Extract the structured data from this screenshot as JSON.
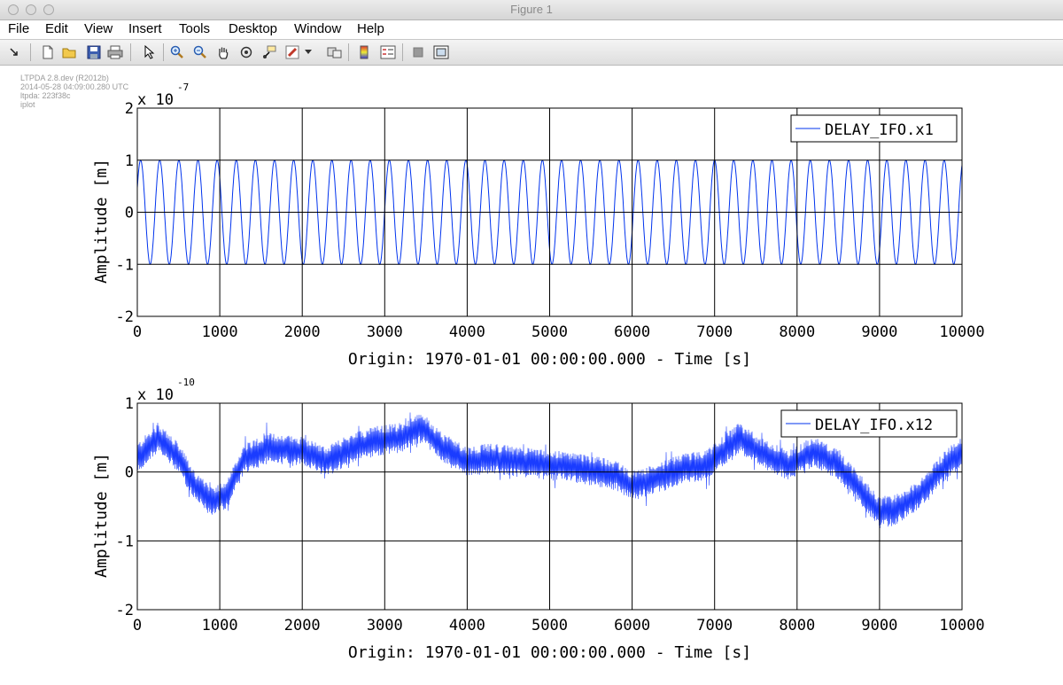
{
  "window": {
    "title": "Figure 1"
  },
  "menu": [
    "File",
    "Edit",
    "View",
    "Insert",
    "Tools",
    "Desktop",
    "Window",
    "Help"
  ],
  "toolbar": {
    "buttons": [
      "dock-arrow-icon",
      "new-figure-icon",
      "open-file-icon",
      "save-icon",
      "print-icon",
      "edit-plot-arrow-icon",
      "zoom-in-icon",
      "zoom-out-icon",
      "pan-hand-icon",
      "rotate-3d-icon",
      "data-cursor-icon",
      "brush-icon",
      "brush-dropdown-icon",
      "link-plot-icon",
      "colorbar-icon",
      "legend-icon",
      "hide-plot-tools-icon",
      "show-plot-tools-icon"
    ]
  },
  "metadata": [
    "LTPDA 2.8.dev (R2012b)",
    "2014-05-28 04:09:00.280 UTC",
    "ltpda: 223f38c",
    "iplot"
  ],
  "colors": {
    "line": "#0033ee",
    "fill": "#1a3cff",
    "grid": "#000000"
  },
  "chart_data": [
    {
      "type": "line",
      "title": "",
      "xlabel": "Origin: 1970-01-01 00:00:00.000 - Time  [s]",
      "ylabel": "Amplitude  [m]",
      "exponent_label": "x 10",
      "exponent": "-7",
      "xlim": [
        0,
        10000
      ],
      "ylim": [
        -2,
        2
      ],
      "xticks": [
        "0",
        "1000",
        "2000",
        "3000",
        "4000",
        "5000",
        "6000",
        "7000",
        "8000",
        "9000",
        "10000"
      ],
      "yticks": [
        "2",
        "1",
        "0",
        "-1",
        "-2"
      ],
      "grid": true,
      "legend_position": "top-right",
      "series": [
        {
          "name": "DELAY_IFO.x1",
          "amplitude": 1,
          "period_s": 232,
          "phase_peak_s": 40,
          "x_start": 0,
          "x_end": 10000
        }
      ]
    },
    {
      "type": "line",
      "title": "",
      "xlabel": "Origin: 1970-01-01 00:00:00.000 - Time  [s]",
      "ylabel": "Amplitude  [m]",
      "exponent_label": "x 10",
      "exponent": "-10",
      "xlim": [
        0,
        10000
      ],
      "ylim": [
        -2,
        1
      ],
      "xticks": [
        "0",
        "1000",
        "2000",
        "3000",
        "4000",
        "5000",
        "6000",
        "7000",
        "8000",
        "9000",
        "10000"
      ],
      "yticks": [
        "1",
        "0",
        "-1",
        "-2"
      ],
      "grid": true,
      "legend_position": "top-right",
      "series": [
        {
          "name": "DELAY_IFO.x12",
          "x": [
            0,
            250,
            500,
            700,
            900,
            1100,
            1300,
            1600,
            2000,
            2300,
            2600,
            2900,
            3200,
            3450,
            3700,
            4000,
            4300,
            4600,
            5000,
            5400,
            5800,
            6000,
            6300,
            6600,
            6900,
            7300,
            7600,
            7900,
            8200,
            8500,
            8800,
            9000,
            9200,
            9500,
            9800,
            10000
          ],
          "center": [
            0.2,
            0.5,
            0.2,
            -0.2,
            -0.45,
            -0.3,
            0.2,
            0.35,
            0.3,
            0.15,
            0.35,
            0.45,
            0.5,
            0.65,
            0.35,
            0.15,
            0.2,
            0.15,
            0.1,
            0.05,
            -0.05,
            -0.2,
            -0.1,
            0.05,
            0.1,
            0.5,
            0.25,
            0.1,
            0.3,
            0.1,
            -0.3,
            -0.6,
            -0.55,
            -0.3,
            0.1,
            0.3
          ],
          "band_halfwidth": 0.22,
          "spike": 0.18
        }
      ]
    }
  ]
}
